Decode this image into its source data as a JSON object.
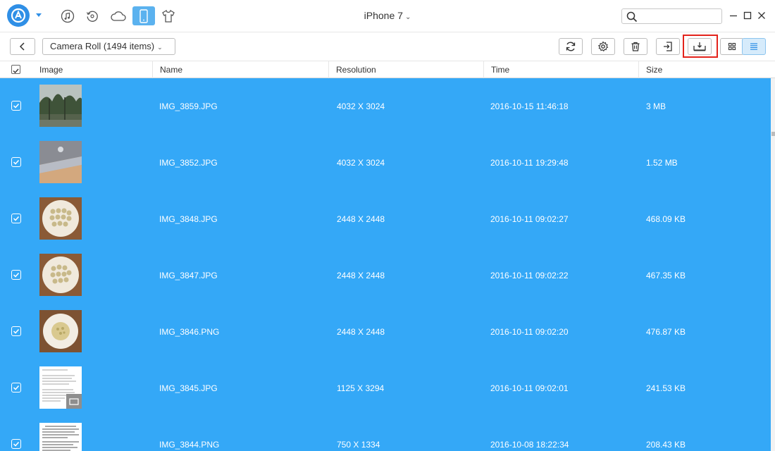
{
  "titlebar": {
    "device_name": "iPhone 7",
    "search": {
      "placeholder": "",
      "value": ""
    },
    "nav_icons": [
      "music-icon",
      "history-icon",
      "cloud-icon",
      "phone-icon",
      "tshirt-icon"
    ],
    "active_nav": "phone-icon"
  },
  "toolbar": {
    "album_label": "Camera Roll (1494 items)",
    "buttons": [
      "refresh-icon",
      "settings-icon",
      "trash-icon",
      "import-icon",
      "export-to-pc-icon",
      "grid-view-icon",
      "list-view-icon"
    ],
    "active_view": "list-view-icon",
    "highlighted_button": "export-to-pc-icon"
  },
  "table": {
    "columns": [
      "Image",
      "Name",
      "Resolution",
      "Time",
      "Size"
    ],
    "rows": [
      {
        "name": "IMG_3859.JPG",
        "resolution": "4032 X 3024",
        "time": "2016-10-15 11:46:18",
        "size": "3 MB",
        "checked": true,
        "thumb": "trees"
      },
      {
        "name": "IMG_3852.JPG",
        "resolution": "4032 X 3024",
        "time": "2016-10-11 19:29:48",
        "size": "1.52 MB",
        "checked": true,
        "thumb": "laptop"
      },
      {
        "name": "IMG_3848.JPG",
        "resolution": "2448 X 2448",
        "time": "2016-10-11 09:02:27",
        "size": "468.09 KB",
        "checked": true,
        "thumb": "plate-many"
      },
      {
        "name": "IMG_3847.JPG",
        "resolution": "2448 X 2448",
        "time": "2016-10-11 09:02:22",
        "size": "467.35 KB",
        "checked": true,
        "thumb": "plate-many"
      },
      {
        "name": "IMG_3846.PNG",
        "resolution": "2448 X 2448",
        "time": "2016-10-11 09:02:20",
        "size": "476.87 KB",
        "checked": true,
        "thumb": "plate-one"
      },
      {
        "name": "IMG_3845.JPG",
        "resolution": "1125 X 3294",
        "time": "2016-10-11 09:02:01",
        "size": "241.53 KB",
        "checked": true,
        "thumb": "text-doc"
      },
      {
        "name": "IMG_3844.PNG",
        "resolution": "750 X 1334",
        "time": "2016-10-08 18:22:34",
        "size": "208.43 KB",
        "checked": true,
        "thumb": "text-doc2"
      }
    ]
  },
  "colors": {
    "selection": "#34a8f7",
    "accent": "#2f8fe6",
    "highlight": "#e3231b"
  }
}
